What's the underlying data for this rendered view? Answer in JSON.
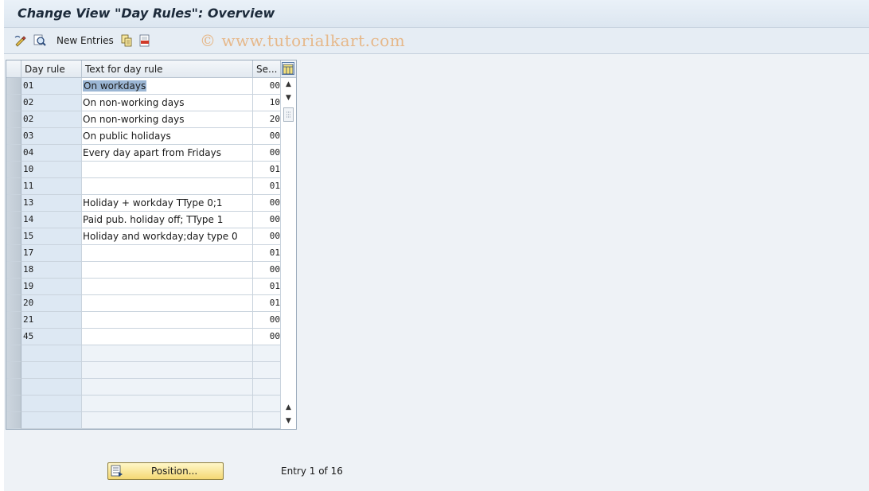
{
  "window": {
    "title": "Change View \"Day Rules\": Overview"
  },
  "toolbar": {
    "new_entries_label": "New Entries",
    "watermark": "© www.tutorialkart.com",
    "icons": [
      "display-change-icon",
      "find-icon",
      "copy-icon",
      "delete-icon"
    ]
  },
  "table": {
    "columns": [
      "Day rule",
      "Text for day rule",
      "Se..."
    ],
    "rows": [
      {
        "rule": "01",
        "text": "On workdays",
        "seq": "00"
      },
      {
        "rule": "02",
        "text": "On non-working days",
        "seq": "10"
      },
      {
        "rule": "02",
        "text": "On non-working days",
        "seq": "20"
      },
      {
        "rule": "03",
        "text": "On public holidays",
        "seq": "00"
      },
      {
        "rule": "04",
        "text": "Every day apart from Fridays",
        "seq": "00"
      },
      {
        "rule": "10",
        "text": "",
        "seq": "01"
      },
      {
        "rule": "11",
        "text": "",
        "seq": "01"
      },
      {
        "rule": "13",
        "text": "Holiday + workday TType 0;1",
        "seq": "00"
      },
      {
        "rule": "14",
        "text": "Paid pub. holiday off; TType 1",
        "seq": "00"
      },
      {
        "rule": "15",
        "text": "Holiday and workday;day type 0",
        "seq": "00"
      },
      {
        "rule": "17",
        "text": "",
        "seq": "01"
      },
      {
        "rule": "18",
        "text": "",
        "seq": "00"
      },
      {
        "rule": "19",
        "text": "",
        "seq": "01"
      },
      {
        "rule": "20",
        "text": "",
        "seq": "01"
      },
      {
        "rule": "21",
        "text": "",
        "seq": "00"
      },
      {
        "rule": "45",
        "text": "",
        "seq": "00"
      }
    ],
    "empty_rows": 5
  },
  "footer": {
    "position_button_label": "Position...",
    "entry_info": "Entry 1 of 16"
  },
  "colors": {
    "position_button": "#f4d874",
    "key_column_bg": "#dde8f3",
    "selection_highlight": "#9bb6d4",
    "watermark": "#e6b88a"
  }
}
